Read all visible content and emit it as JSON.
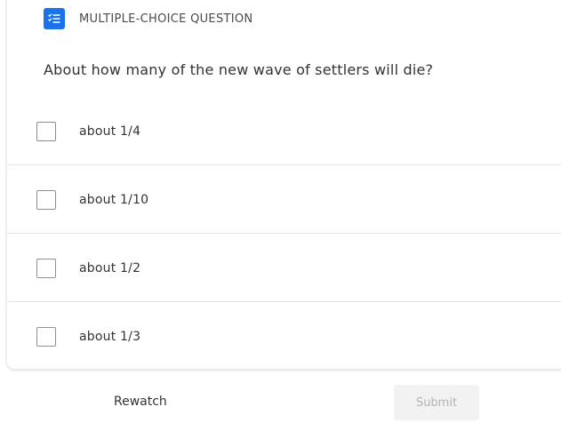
{
  "header": {
    "type_label": "MULTIPLE-CHOICE QUESTION",
    "icon": "checklist-icon",
    "accent_color": "#1a73e8"
  },
  "question": {
    "text": "About how many of the new wave of settlers will die?"
  },
  "options": [
    {
      "label": "about 1/4",
      "checked": false
    },
    {
      "label": "about 1/10",
      "checked": false
    },
    {
      "label": "about 1/2",
      "checked": false
    },
    {
      "label": "about 1/3",
      "checked": false
    }
  ],
  "footer": {
    "rewatch_label": "Rewatch",
    "submit_label": "Submit",
    "submit_enabled": false
  }
}
